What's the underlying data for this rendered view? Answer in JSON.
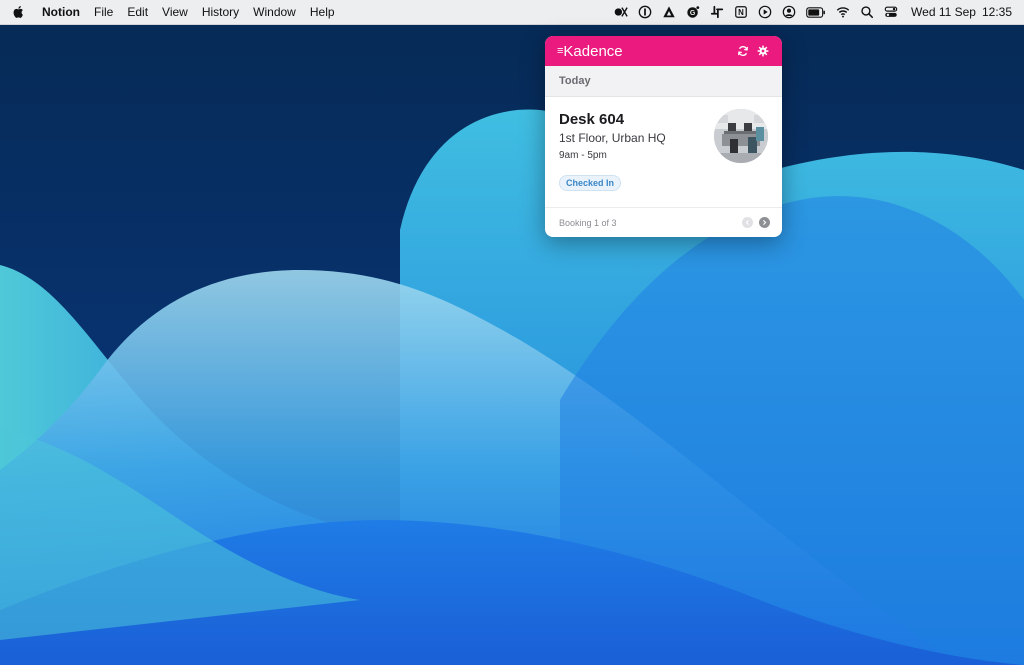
{
  "menubar": {
    "app_name": "Notion",
    "menus": [
      "File",
      "Edit",
      "View",
      "History",
      "Window",
      "Help"
    ],
    "clock": {
      "date": "Wed 11 Sep",
      "time": "12:35"
    },
    "tray_icons": [
      "x-icon",
      "one-password-icon",
      "vectorworks-icon",
      "grammarly-icon",
      "slack-icon",
      "notion-icon",
      "play-icon",
      "user-icon",
      "battery-icon",
      "wifi-icon",
      "search-icon",
      "control-center-icon"
    ]
  },
  "popup": {
    "brand": "Kadence",
    "brand_mark": "≡",
    "accent_color": "#ea1a7f",
    "section_label": "Today",
    "booking": {
      "title": "Desk 604",
      "location": "1st Floor, Urban HQ",
      "time": "9am - 5pm",
      "status": "Checked In"
    },
    "pager": "Booking 1 of 3"
  }
}
